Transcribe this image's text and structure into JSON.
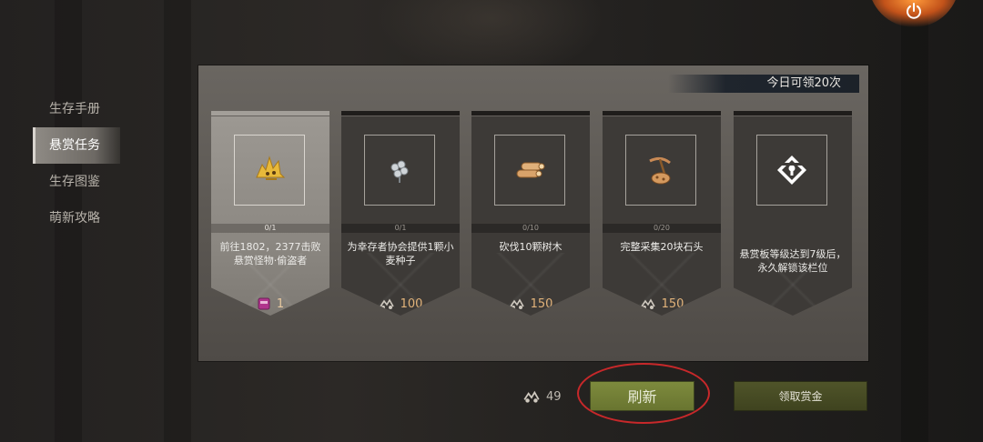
{
  "nav": {
    "items": [
      {
        "label": "生存手册",
        "active": false
      },
      {
        "label": "悬赏任务",
        "active": true
      },
      {
        "label": "生存图鉴",
        "active": false
      },
      {
        "label": "萌新攻略",
        "active": false
      }
    ]
  },
  "panel": {
    "daily_limit": "今日可领20次"
  },
  "cards": [
    {
      "icon": "monster-thief-icon",
      "progress": "0/1",
      "description": "前往1802，2377击败悬赏怪物·偷盗者",
      "reward_icon": "ticket-icon",
      "reward": "1",
      "selected": true
    },
    {
      "icon": "wheat-seed-icon",
      "progress": "0/1",
      "description": "为幸存者协会提供1颗小麦种子",
      "reward_icon": "currency-icon",
      "reward": "100",
      "selected": false
    },
    {
      "icon": "wood-log-icon",
      "progress": "0/10",
      "description": "砍伐10颗树木",
      "reward_icon": "currency-icon",
      "reward": "150",
      "selected": false
    },
    {
      "icon": "pickaxe-stone-icon",
      "progress": "0/20",
      "description": "完整采集20块石头",
      "reward_icon": "currency-icon",
      "reward": "150",
      "selected": false
    },
    {
      "icon": "lock-slot-icon",
      "progress": "",
      "description": "悬赏板等级达到7级后，永久解锁该栏位",
      "reward_icon": "",
      "reward": "",
      "selected": false
    }
  ],
  "footer": {
    "currency_amount": "49",
    "refresh_label": "刷新",
    "claim_label": "领取赏金"
  },
  "colors": {
    "refresh_button": "#7d8a3d",
    "claim_button": "#4f5429",
    "highlight_ring": "#c7282a",
    "reward_text": "#e2b37a"
  }
}
